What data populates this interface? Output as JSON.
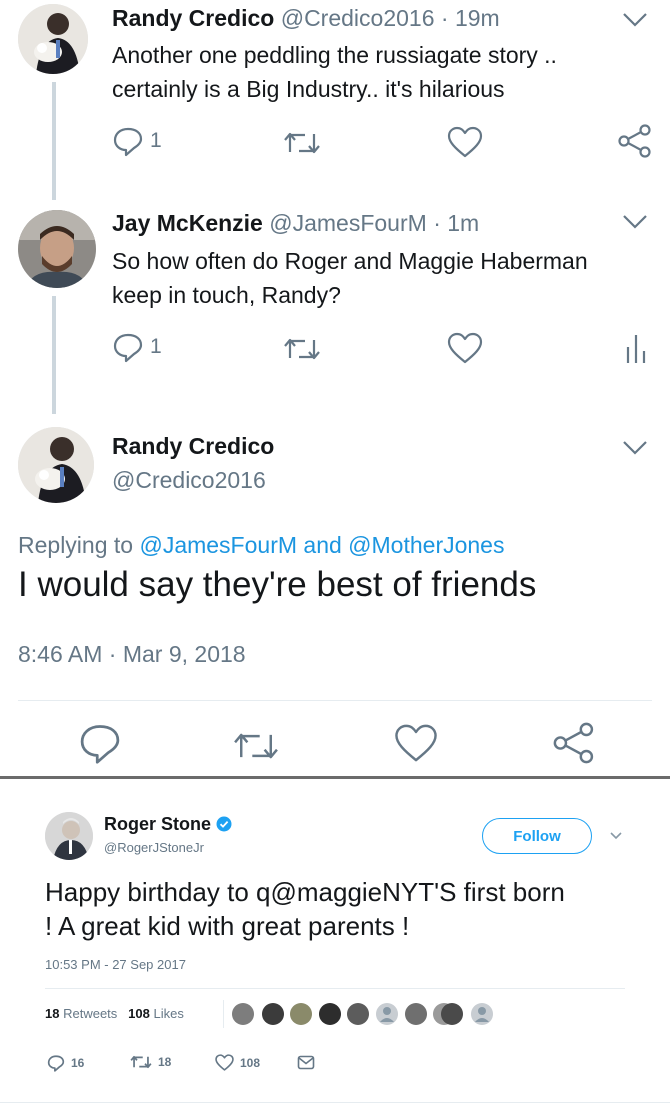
{
  "tweets": [
    {
      "name": "Randy Credico",
      "handle": "@Credico2016",
      "time": "· 19m",
      "text_lines": [
        "Another one peddling the russiagate story ..",
        "certainly is a Big Industry.. it's hilarious"
      ],
      "reply_count": "1"
    },
    {
      "name": "Jay McKenzie",
      "handle": "@JamesFourM",
      "time": "· 1m",
      "text_lines": [
        "So how often do Roger and Maggie Haberman",
        "keep in touch, Randy?"
      ],
      "reply_count": "1"
    }
  ],
  "focused": {
    "name": "Randy Credico",
    "handle": "@Credico2016",
    "replying_prefix": "Replying to",
    "mention1": "@JamesFourM",
    "and": "and",
    "mention2": "@MotherJones",
    "text": "I would say they're best of friends",
    "timestamp": "8:46 AM · Mar 9, 2018"
  },
  "embedded": {
    "name": "Roger Stone",
    "handle": "@RogerJStoneJr",
    "follow_label": "Follow",
    "text_lines": [
      "Happy birthday to q@maggieNYT'S first born",
      "! A great kid with great parents !"
    ],
    "time": "10:53 PM - 27 Sep 2017",
    "retweets": "18",
    "retweets_label": "Retweets",
    "likes": "108",
    "likes_label": "Likes",
    "reply_count": "16",
    "retweet_count": "18",
    "like_count": "108"
  },
  "colors": {
    "icon_gray": "#657786",
    "link_blue": "#1b95e0",
    "follow_blue": "#1da1f2",
    "verified_blue": "#1da1f2"
  },
  "icons": [
    "chevron-down-icon",
    "reply-icon",
    "retweet-icon",
    "like-icon",
    "share-icon",
    "analytics-icon",
    "dm-icon",
    "verified-icon"
  ]
}
